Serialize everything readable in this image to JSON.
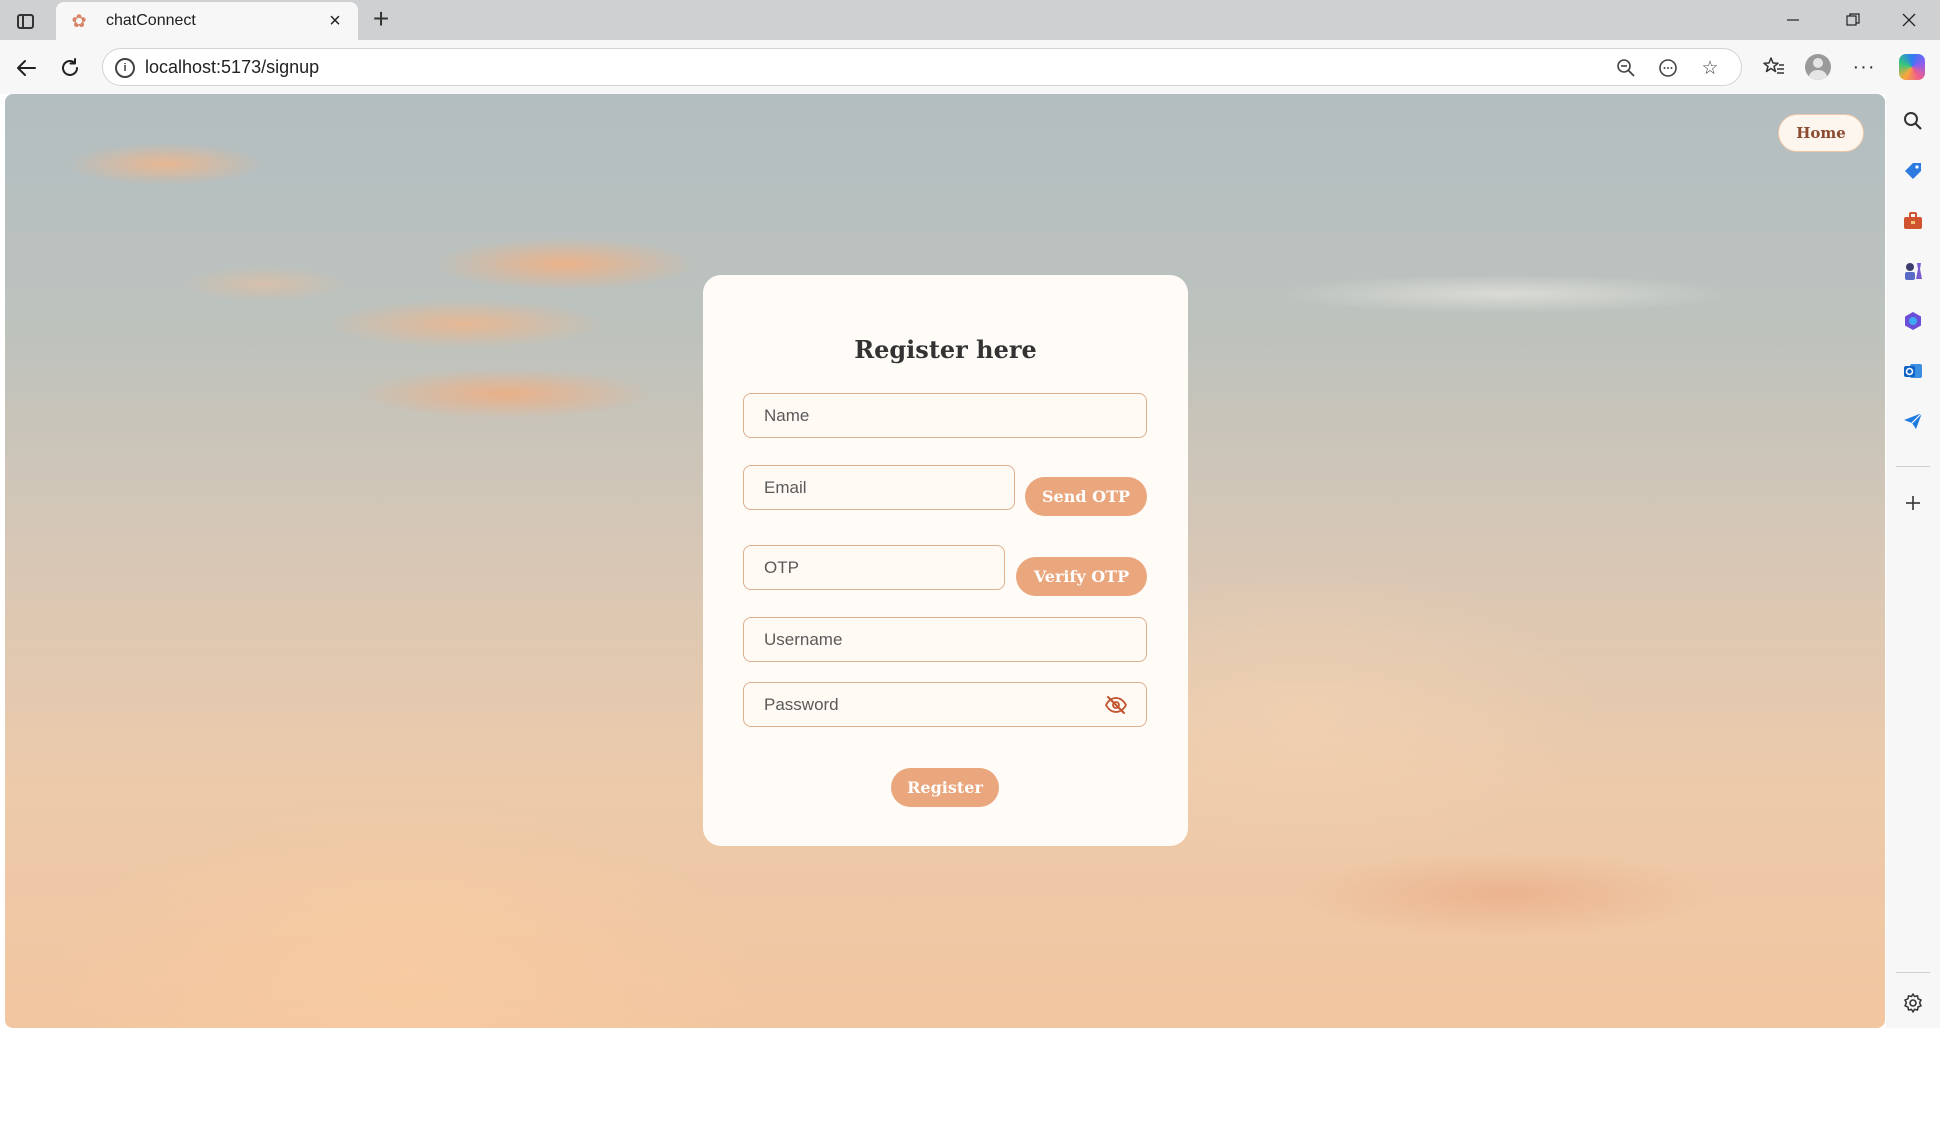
{
  "browser": {
    "tab_title": "chatConnect",
    "url": "localhost:5173/signup"
  },
  "icons": {
    "tab_favicon": "flower-icon",
    "sidebar": [
      "search-icon",
      "tag-icon",
      "briefcase-icon",
      "chess-icon",
      "office-icon",
      "outlook-icon",
      "send-icon",
      "plus-icon",
      "settings-icon"
    ]
  },
  "colors": {
    "accent": "#eaa67d",
    "card_bg": "#fffcf8",
    "field_border": "#ddb08e"
  },
  "page": {
    "home_label": "Home",
    "form": {
      "title": "Register here",
      "name_placeholder": "Name",
      "email_placeholder": "Email",
      "send_otp_label": "Send OTP",
      "otp_placeholder": "OTP",
      "verify_otp_label": "Verify OTP",
      "username_placeholder": "Username",
      "password_placeholder": "Password",
      "register_label": "Register"
    }
  }
}
